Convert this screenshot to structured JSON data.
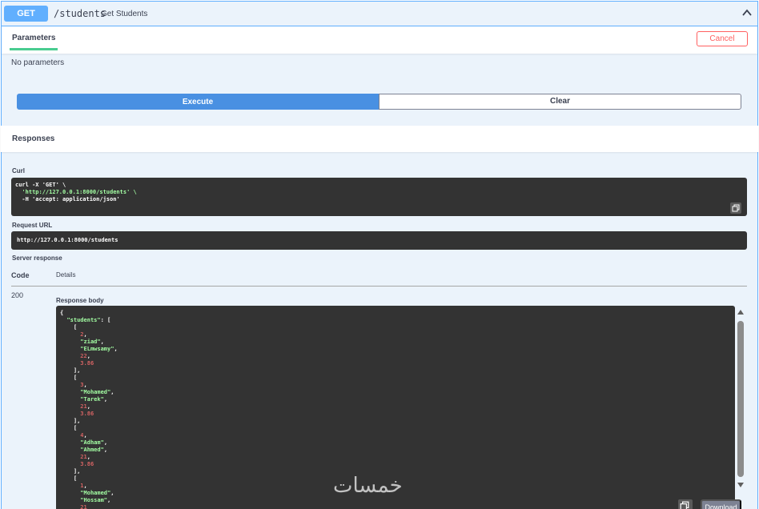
{
  "summary": {
    "method": "GET",
    "path": "/students",
    "description": "Get Students"
  },
  "parameters": {
    "tab_label": "Parameters",
    "cancel_label": "Cancel",
    "empty_text": "No parameters"
  },
  "actions": {
    "execute_label": "Execute",
    "clear_label": "Clear"
  },
  "responses": {
    "title": "Responses",
    "curl_label": "Curl",
    "curl_lines": [
      "curl -X 'GET' \\",
      "  'http://127.0.0.1:8000/students' \\",
      "  -H 'accept: application/json'"
    ],
    "request_url_label": "Request URL",
    "request_url": "http://127.0.0.1:8000/students",
    "server_response_label": "Server response",
    "code_header": "Code",
    "details_header": "Details",
    "status_code": "200",
    "response_body_label": "Response body",
    "download_label": "Download"
  },
  "response_body": {
    "root_key": "students",
    "students": [
      [
        2,
        "ziad",
        "ELmwsamy",
        22,
        3.86
      ],
      [
        3,
        "Mohamed",
        "Tarek",
        21,
        3.86
      ],
      [
        4,
        "Adham",
        "Ahmed",
        21,
        3.86
      ],
      [
        1,
        "Mohamed",
        "Hossam",
        21
      ]
    ]
  },
  "watermark_text": "خمسات",
  "colors": {
    "get_accent": "#61affe",
    "execute": "#4990e2",
    "cancel": "#ff6060",
    "tab_underline": "#49cc90",
    "code_bg": "#333333",
    "string": "#a2fca2",
    "number": "#d36363"
  },
  "icons": {
    "collapse": "chevron-up-icon",
    "copy": "copy-icon",
    "scroll_up": "scroll-up-arrow-icon",
    "scroll_down": "scroll-down-arrow-icon"
  }
}
